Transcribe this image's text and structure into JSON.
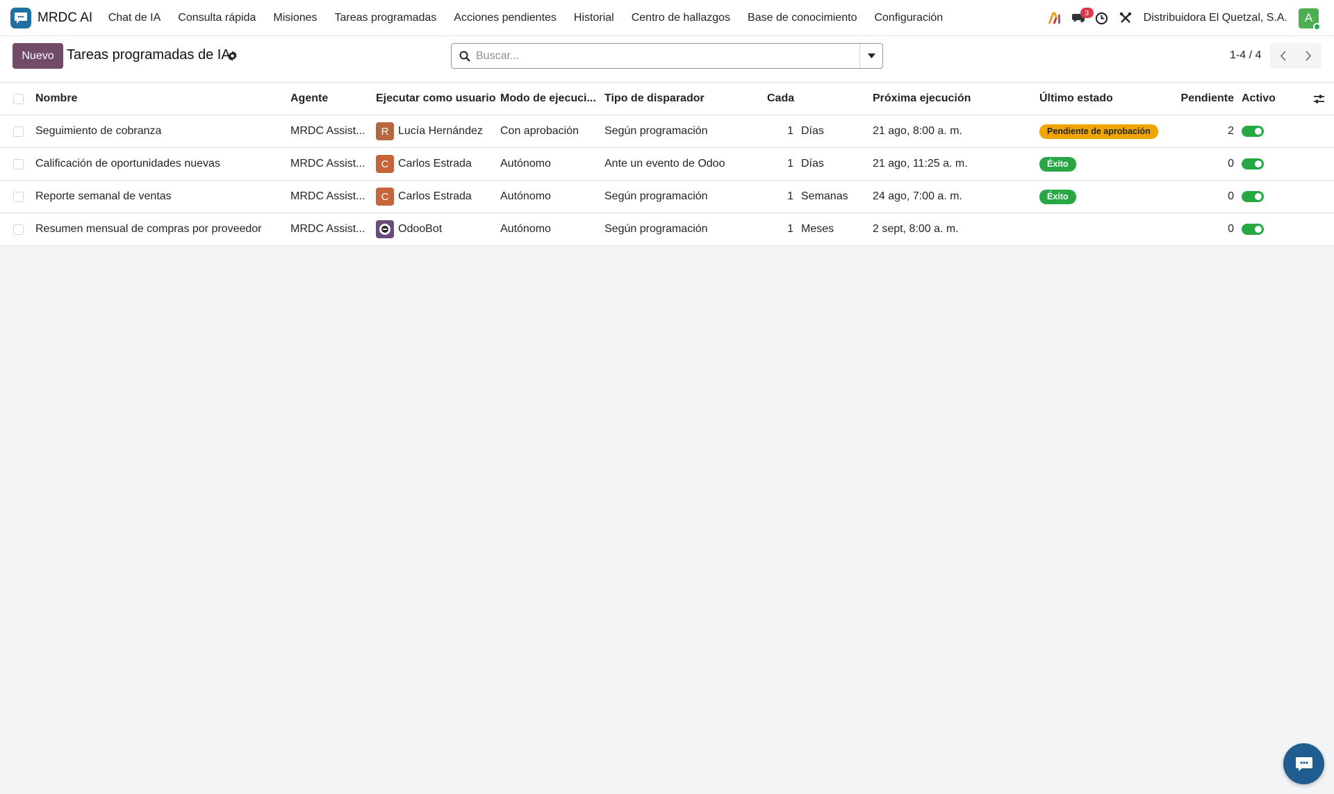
{
  "app": {
    "name": "MRDC AI",
    "logo_color": "#1f6fa3"
  },
  "menu": [
    {
      "label": "Chat de IA"
    },
    {
      "label": "Consulta rápida"
    },
    {
      "label": "Misiones"
    },
    {
      "label": "Tareas programadas"
    },
    {
      "label": "Acciones pendientes"
    },
    {
      "label": "Historial"
    },
    {
      "label": "Centro de hallazgos"
    },
    {
      "label": "Base de conocimiento"
    },
    {
      "label": "Configuración"
    }
  ],
  "systray": {
    "chat_badge": "3",
    "company": "Distribuidora El Quetzal, S.A.",
    "user_initial": "A",
    "icons": [
      "ai-icon",
      "chat-icon",
      "clock-icon",
      "tools-icon"
    ]
  },
  "control_panel": {
    "new_label": "Nuevo",
    "title": "Tareas programadas de IA",
    "search_placeholder": "Buscar...",
    "pager": "1-4 / 4"
  },
  "table": {
    "headers": {
      "name": "Nombre",
      "agent": "Agente",
      "run_as": "Ejecutar como usuario",
      "mode": "Modo de ejecuci...",
      "trigger": "Tipo de disparador",
      "every": "Cada",
      "next_run": "Próxima ejecución",
      "last_status": "Último estado",
      "pending": "Pendiente",
      "active": "Activo"
    },
    "rows": [
      {
        "name": "Seguimiento de cobranza",
        "agent": "MRDC Assist...",
        "user_initial": "R",
        "user": "Lucía Hernández",
        "user_color": "#b5673e",
        "mode": "Con aprobación",
        "trigger": "Según programación",
        "every_n": "1",
        "every_unit": "Días",
        "next_run": "21 ago, 8:00 a. m.",
        "status": "Pendiente de aprobación",
        "status_color": "#f0a500",
        "pending": "2",
        "active": true
      },
      {
        "name": "Calificación de oportunidades nuevas",
        "agent": "MRDC Assist...",
        "user_initial": "C",
        "user": "Carlos Estrada",
        "user_color": "#c8643a",
        "mode": "Autónomo",
        "trigger": "Ante un evento de Odoo",
        "every_n": "1",
        "every_unit": "Días",
        "next_run": "21 ago, 11:25 a. m.",
        "status": "Éxito",
        "status_color": "#28a745",
        "pending": "0",
        "active": true
      },
      {
        "name": "Reporte semanal de ventas",
        "agent": "MRDC Assist...",
        "user_initial": "C",
        "user": "Carlos Estrada",
        "user_color": "#c8643a",
        "mode": "Autónomo",
        "trigger": "Según programación",
        "every_n": "1",
        "every_unit": "Semanas",
        "next_run": "24 ago, 7:00 a. m.",
        "status": "Éxito",
        "status_color": "#28a745",
        "pending": "0",
        "active": true
      },
      {
        "name": "Resumen mensual de compras por proveedor",
        "agent": "MRDC Assist...",
        "user_initial": "",
        "user": "OdooBot",
        "user_color": "#6b4a7e",
        "mode": "Autónomo",
        "trigger": "Según programación",
        "every_n": "1",
        "every_unit": "Meses",
        "next_run": "2 sept, 8:00 a. m.",
        "status": "",
        "status_color": "",
        "pending": "0",
        "active": true
      }
    ]
  },
  "colors": {
    "primary": "#714b67",
    "success": "#28a745",
    "warning": "#f0a500"
  }
}
